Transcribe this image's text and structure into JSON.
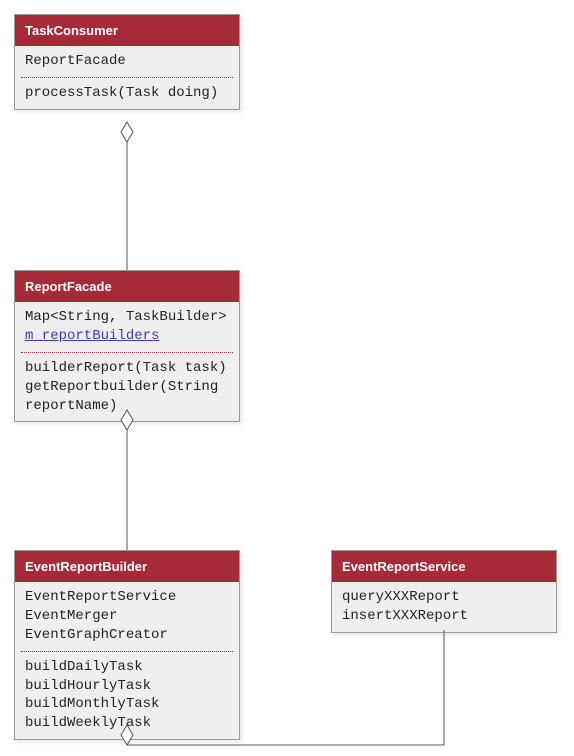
{
  "classes": {
    "taskConsumer": {
      "name": "TaskConsumer",
      "attrs": [
        "ReportFacade"
      ],
      "ops": [
        "processTask(Task doing)"
      ]
    },
    "reportFacade": {
      "name": "ReportFacade",
      "attrs_line1": "Map<String, TaskBuilder>",
      "attrs_link": "m_reportBuilders",
      "ops": [
        "builderReport(Task task)",
        "getReportbuilder(String",
        "reportName)"
      ]
    },
    "eventReportBuilder": {
      "name": "EventReportBuilder",
      "attrs": [
        "EventReportService",
        "EventMerger",
        "EventGraphCreator"
      ],
      "ops": [
        "buildDailyTask",
        "buildHourlyTask",
        "buildMonthlyTask",
        "buildWeeklyTask"
      ]
    },
    "eventReportService": {
      "name": "EventReportService",
      "ops": [
        "queryXXXReport",
        "insertXXXReport"
      ]
    }
  }
}
